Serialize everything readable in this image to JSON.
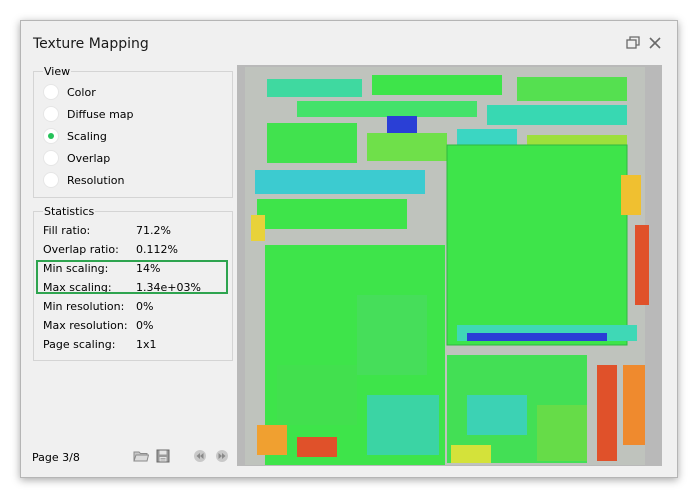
{
  "window": {
    "title": "Texture Mapping"
  },
  "view_group": {
    "title": "View",
    "options": [
      {
        "label": "Color",
        "selected": false
      },
      {
        "label": "Diffuse map",
        "selected": false
      },
      {
        "label": "Scaling",
        "selected": true
      },
      {
        "label": "Overlap",
        "selected": false
      },
      {
        "label": "Resolution",
        "selected": false
      }
    ]
  },
  "stats_group": {
    "title": "Statistics",
    "rows": [
      {
        "label": "Fill ratio:",
        "value": "71.2%"
      },
      {
        "label": "Overlap ratio:",
        "value": "0.112%"
      },
      {
        "label": "Min scaling:",
        "value": "14%"
      },
      {
        "label": "Max scaling:",
        "value": "1.34e+03%"
      },
      {
        "label": "Min resolution:",
        "value": "0%"
      },
      {
        "label": "Max resolution:",
        "value": "0%"
      },
      {
        "label": "Page scaling:",
        "value": "1x1"
      }
    ]
  },
  "footer": {
    "page": "Page 3/8"
  },
  "icons": {
    "restore": "restore-window-icon",
    "close": "close-icon",
    "open": "folder-icon",
    "save": "save-icon",
    "prev": "previous-page-icon",
    "next": "next-page-icon"
  },
  "colors": {
    "selected_radio": "#25c259",
    "highlight_border": "#2ea44f",
    "scaling_green": "#3ee44a",
    "scaling_cyan": "#37d6b0",
    "scaling_blue": "#2a3fd6",
    "scaling_red": "#e0512a",
    "scaling_orange": "#f0a030"
  }
}
